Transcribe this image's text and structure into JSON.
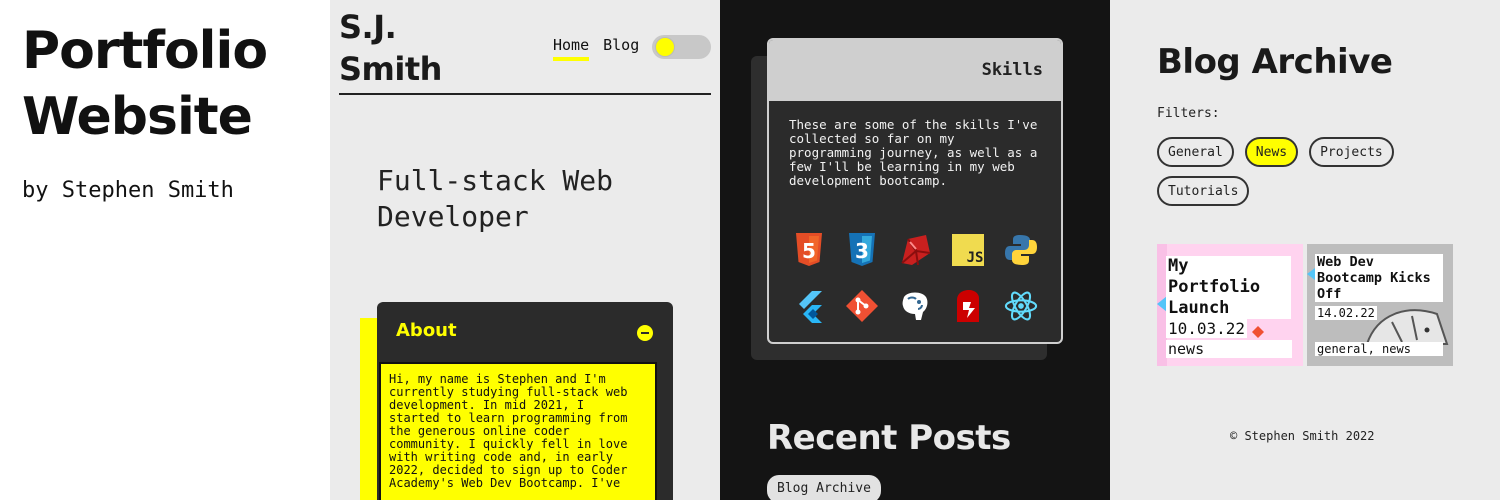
{
  "showcase": {
    "title_line1": "Portfolio",
    "title_line2": "Website",
    "byline": "by Stephen Smith"
  },
  "home": {
    "logo_line1": "S.J.",
    "logo_line2": "Smith",
    "nav": {
      "home": "Home",
      "blog": "Blog"
    },
    "theme_toggle_icon": "toggle-switch-icon",
    "hero": "Full-stack Web\nDeveloper",
    "about": {
      "heading": "About",
      "collapse_icon": "minus-circle-icon",
      "body": "Hi, my name is Stephen and I'm\ncurrently studying full-stack web\ndevelopment. In mid 2021, I\nstarted to learn programming from\nthe generous online coder\ncommunity. I quickly fell in love\nwith writing code and, in early\n2022, decided to sign up to Coder\nAcademy's Web Dev Bootcamp. I've"
    },
    "colors": {
      "accent": "#ffff00",
      "background": "#ebebeb",
      "card": "#2b2b2b"
    }
  },
  "dark": {
    "skills": {
      "heading": "Skills",
      "description": "These are some of the skills I've\ncollected so far on my\nprogramming journey, as well as a\nfew I'll be learning in my web\ndevelopment bootcamp.",
      "icons": [
        {
          "name": "html5-icon",
          "glyph": "5"
        },
        {
          "name": "css3-icon",
          "glyph": "3"
        },
        {
          "name": "ruby-icon",
          "glyph": ""
        },
        {
          "name": "javascript-icon",
          "glyph": "JS"
        },
        {
          "name": "python-icon",
          "glyph": ""
        },
        {
          "name": "flutter-icon",
          "glyph": ""
        },
        {
          "name": "git-icon",
          "glyph": ""
        },
        {
          "name": "postgresql-icon",
          "glyph": ""
        },
        {
          "name": "rails-icon",
          "glyph": ""
        },
        {
          "name": "react-icon",
          "glyph": ""
        }
      ]
    },
    "recent_posts_heading": "Recent Posts",
    "archive_button": "Blog Archive",
    "colors": {
      "background": "#141414",
      "card_header": "#cfcfcf"
    }
  },
  "archive": {
    "heading": "Blog Archive",
    "filters_label": "Filters:",
    "filters": [
      {
        "label": "General",
        "active": false
      },
      {
        "label": "News",
        "active": true
      },
      {
        "label": "Projects",
        "active": false
      },
      {
        "label": "Tutorials",
        "active": false
      }
    ],
    "posts": [
      {
        "title": "My Portfolio Launch",
        "date": "10.03.22",
        "tags": "news"
      },
      {
        "title": "Web Dev Bootcamp Kicks Off",
        "date": "14.02.22",
        "tags": "general, news"
      }
    ],
    "footer": "© Stephen Smith 2022"
  }
}
